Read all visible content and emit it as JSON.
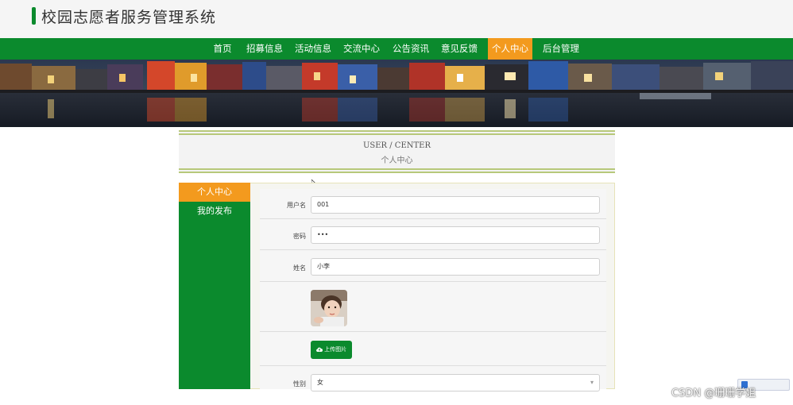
{
  "header": {
    "title": "校园志愿者服务管理系统"
  },
  "nav": {
    "items": [
      {
        "label": "首页"
      },
      {
        "label": "招募信息"
      },
      {
        "label": "活动信息"
      },
      {
        "label": "交流中心"
      },
      {
        "label": "公告资讯"
      },
      {
        "label": "意见反馈"
      },
      {
        "label": "个人中心",
        "active": true
      },
      {
        "label": "后台管理"
      }
    ]
  },
  "section": {
    "title_en": "USER / CENTER",
    "title_cn": "个人中心"
  },
  "sidebar": {
    "items": [
      {
        "label": "个人中心",
        "active": true
      },
      {
        "label": "我的发布"
      }
    ]
  },
  "form": {
    "username": {
      "label": "用户名",
      "value": "001"
    },
    "password": {
      "label": "密码",
      "value": "•••"
    },
    "name": {
      "label": "姓名",
      "value": "小李"
    },
    "upload": {
      "label": "上传图片",
      "icon": "cloud-upload-icon"
    },
    "gender": {
      "label": "性别",
      "value": "女"
    }
  },
  "colors": {
    "primary": "#0b8a2d",
    "accent": "#f39a1e"
  },
  "watermark": "CSDN @珊珊学姐"
}
